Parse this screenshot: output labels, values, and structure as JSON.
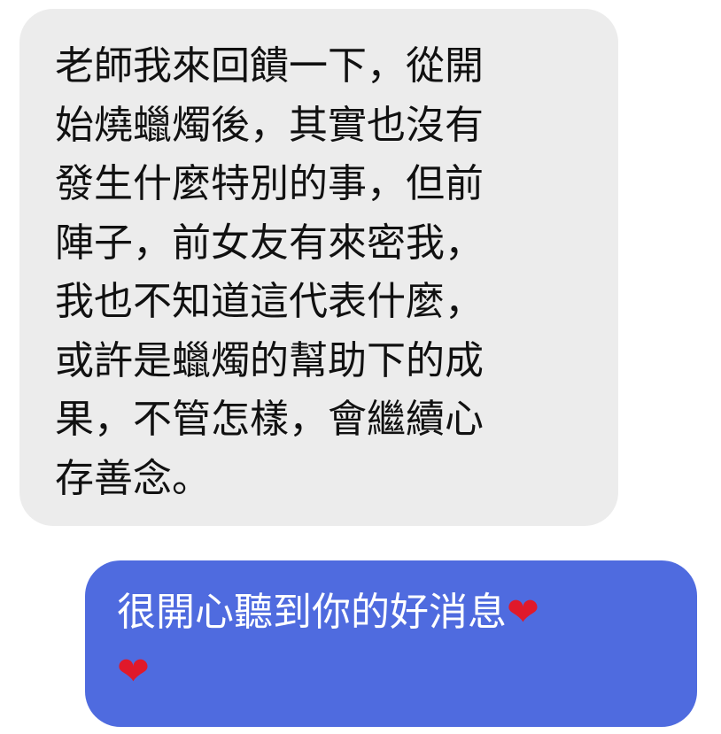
{
  "thread": {
    "incoming_message": {
      "lines": [
        "老師我來回饋一下，從開",
        "始燒蠟燭後，其實也沒有",
        "發生什麼特別的事，但前",
        "陣子，前女友有來密我，",
        "我也不知道這代表什麼，",
        "或許是蠟燭的幫助下的成",
        "果，不管怎樣，會繼續心",
        "存善念。"
      ]
    },
    "outgoing_message": {
      "text": "很開心聽到你的好消息",
      "emoji_1": "❤",
      "emoji_2": "❤"
    }
  },
  "colors": {
    "incoming_bubble": "#ececec",
    "outgoing_bubble": "#4f6bdf",
    "heart": "#e0192a"
  },
  "icons": {
    "heart": "red-heart-icon"
  }
}
